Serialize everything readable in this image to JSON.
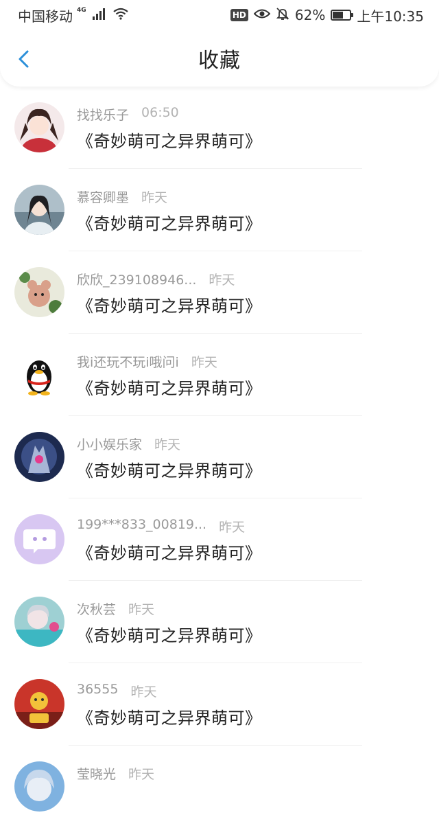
{
  "status_bar": {
    "carrier": "中国移动",
    "network": "4G",
    "battery_percent": "62%",
    "time": "上午10:35",
    "hd_badge": "HD",
    "battery_level": 0.62
  },
  "header": {
    "title": "收藏",
    "back_icon": "chevron-left-icon",
    "accent_color": "#2b8fd9"
  },
  "favorites": [
    {
      "user": "找找乐子",
      "time": "06:50",
      "title": "《奇妙萌可之异界萌可》"
    },
    {
      "user": "慕容卿墨",
      "time": "昨天",
      "title": "《奇妙萌可之异界萌可》"
    },
    {
      "user": "欣欣_239108946...",
      "time": "昨天",
      "title": "《奇妙萌可之异界萌可》"
    },
    {
      "user": "我i还玩不玩i哦问i",
      "time": "昨天",
      "title": "《奇妙萌可之异界萌可》"
    },
    {
      "user": "小小娱乐家",
      "time": "昨天",
      "title": "《奇妙萌可之异界萌可》"
    },
    {
      "user": "199***833_00819...",
      "time": "昨天",
      "title": "《奇妙萌可之异界萌可》"
    },
    {
      "user": "次秋芸",
      "time": "昨天",
      "title": "《奇妙萌可之异界萌可》"
    },
    {
      "user": "36555",
      "time": "昨天",
      "title": "《奇妙萌可之异界萌可》"
    },
    {
      "user": "莹晓光",
      "time": "昨天",
      "title": ""
    }
  ]
}
